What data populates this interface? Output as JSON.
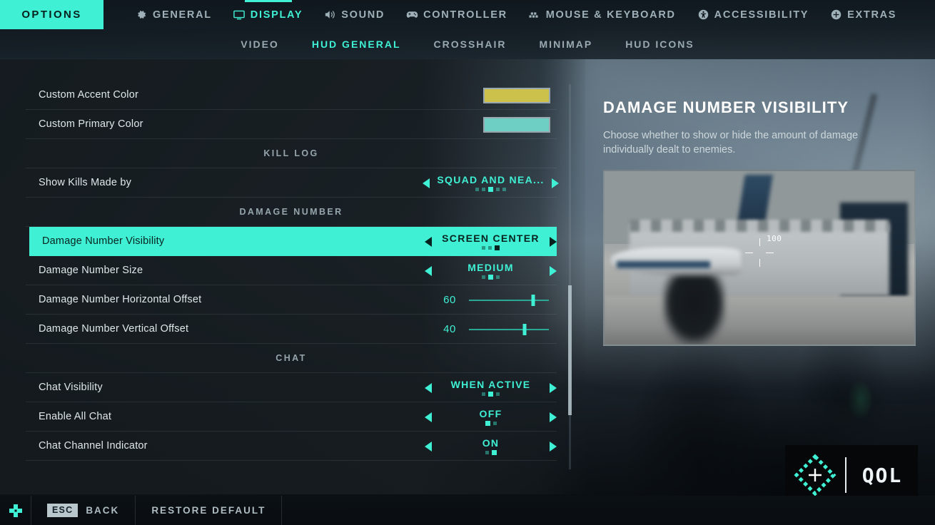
{
  "topnav": {
    "options_label": "OPTIONS",
    "items": [
      {
        "label": "GENERAL",
        "icon": "gear-icon",
        "active": false
      },
      {
        "label": "DISPLAY",
        "icon": "monitor-icon",
        "active": true
      },
      {
        "label": "SOUND",
        "icon": "speaker-icon",
        "active": false
      },
      {
        "label": "CONTROLLER",
        "icon": "gamepad-icon",
        "active": false
      },
      {
        "label": "MOUSE & KEYBOARD",
        "icon": "mouse-keyboard-icon",
        "active": false
      },
      {
        "label": "ACCESSIBILITY",
        "icon": "accessibility-icon",
        "active": false
      },
      {
        "label": "EXTRAS",
        "icon": "plus-circle-icon",
        "active": false
      }
    ]
  },
  "subnav": {
    "items": [
      {
        "label": "VIDEO",
        "active": false
      },
      {
        "label": "HUD GENERAL",
        "active": true
      },
      {
        "label": "CROSSHAIR",
        "active": false
      },
      {
        "label": "MINIMAP",
        "active": false
      },
      {
        "label": "HUD ICONS",
        "active": false
      }
    ]
  },
  "settings": [
    {
      "kind": "swatch",
      "label": "Custom Accent Color",
      "color": "#ccc14a"
    },
    {
      "kind": "swatch",
      "label": "Custom Primary Color",
      "color": "#6ecfc5"
    },
    {
      "kind": "section",
      "label": "KILL LOG"
    },
    {
      "kind": "stepper",
      "label": "Show Kills Made by",
      "value": "SQUAD AND NEA...",
      "dots": 5,
      "active_dot": 3,
      "selected": false
    },
    {
      "kind": "section",
      "label": "DAMAGE NUMBER"
    },
    {
      "kind": "stepper",
      "label": "Damage Number Visibility",
      "value": "SCREEN CENTER",
      "dots": 3,
      "active_dot": 3,
      "selected": true
    },
    {
      "kind": "stepper",
      "label": "Damage Number Size",
      "value": "MEDIUM",
      "dots": 3,
      "active_dot": 2,
      "selected": false
    },
    {
      "kind": "slider",
      "label": "Damage Number Horizontal Offset",
      "value": "60",
      "percent": 80
    },
    {
      "kind": "slider",
      "label": "Damage Number Vertical Offset",
      "value": "40",
      "percent": 70
    },
    {
      "kind": "section",
      "label": "CHAT"
    },
    {
      "kind": "stepper",
      "label": "Chat Visibility",
      "value": "WHEN ACTIVE",
      "dots": 3,
      "active_dot": 2,
      "selected": false
    },
    {
      "kind": "stepper",
      "label": "Enable All Chat",
      "value": "OFF",
      "dots": 2,
      "active_dot": 1,
      "selected": false
    },
    {
      "kind": "stepper",
      "label": "Chat Channel Indicator",
      "value": "ON",
      "dots": 2,
      "active_dot": 2,
      "selected": false
    }
  ],
  "info": {
    "title": "DAMAGE NUMBER VISIBILITY",
    "description": "Choose whether to show or hide the amount of damage individually dealt to enemies.",
    "preview_damage_number": "100"
  },
  "watermark": {
    "text": "QOL",
    "mark": "diamond-crosshair-icon"
  },
  "bottombar": {
    "dpad_icon": "dpad-icon",
    "back_key": "ESC",
    "back_label": "BACK",
    "restore_label": "RESTORE DEFAULT"
  },
  "colors": {
    "accent_teal": "#3ff0d4",
    "panel_bg": "#161c20",
    "text_primary": "#dfe7ea",
    "text_muted": "#96a5ac"
  }
}
